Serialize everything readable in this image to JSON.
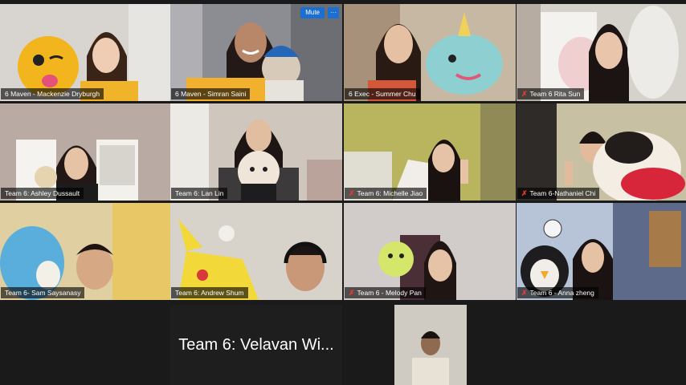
{
  "tiles": [
    {
      "name": "6 Maven - Mackenzie Dryburgh",
      "muted": false
    },
    {
      "name": "6 Maven - Simran Saini",
      "muted": false,
      "buttons": {
        "mute": "Mute",
        "more": "···"
      }
    },
    {
      "name": "6 Exec - Summer Chu",
      "muted": false
    },
    {
      "name": "Team 6 Rita Sun",
      "muted": true
    },
    {
      "name": "Team 6: Ashley Dussault",
      "muted": false
    },
    {
      "name": "Team 6: Lan Lin",
      "muted": false
    },
    {
      "name": "Team 6: Michelle Jiao",
      "muted": true
    },
    {
      "name": "Team 6-Nathaniel Chi",
      "muted": true
    },
    {
      "name": "Team 6- Sam Saysanasy",
      "muted": false
    },
    {
      "name": "Team 6: Andrew Shum",
      "muted": false
    },
    {
      "name": "Team 6 - Melody Pan",
      "muted": true
    },
    {
      "name": "Team 6 - Anna zheng",
      "muted": true
    }
  ],
  "name_only_tile": {
    "label": "Team 6: Velavan Wi..."
  },
  "colors": {
    "speaking_border": "#e8e84a",
    "muted_icon": "#e53935",
    "button_blue": "#1b6fd1"
  },
  "icons": {
    "muted": "mic-muted-icon"
  }
}
